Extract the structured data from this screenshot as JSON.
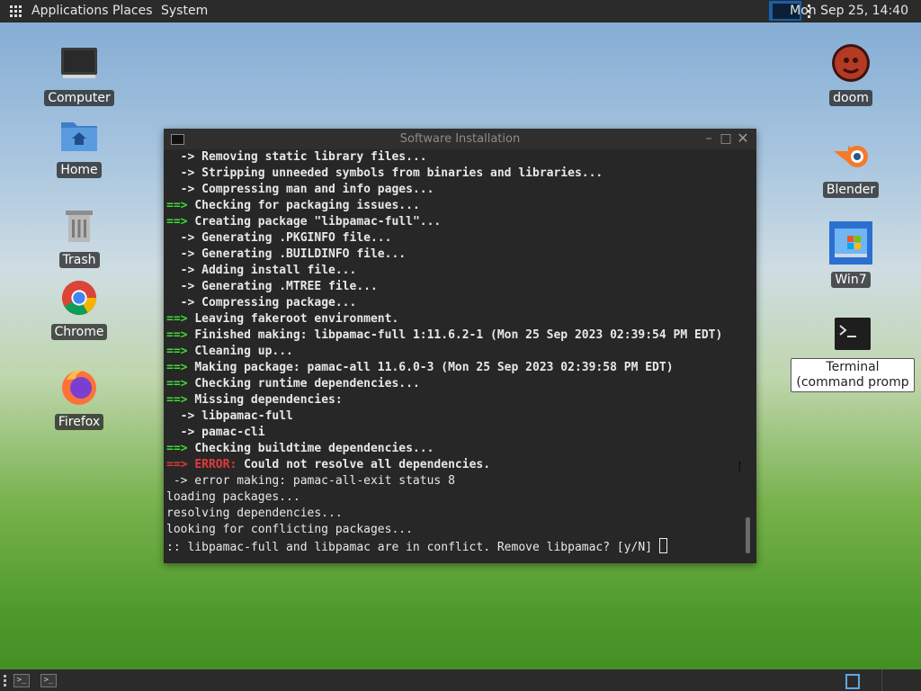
{
  "top_panel": {
    "applications": "Applications",
    "places": "Places",
    "system": "System",
    "clock": "Mon Sep 25, 14:40"
  },
  "desktop_left": [
    {
      "label": "Computer",
      "icon": "computer-icon"
    },
    {
      "label": "Home",
      "icon": "home-folder-icon"
    },
    {
      "label": "Trash",
      "icon": "trash-icon"
    },
    {
      "label": "Chrome",
      "icon": "chrome-icon"
    },
    {
      "label": "Firefox",
      "icon": "firefox-icon"
    }
  ],
  "desktop_right": [
    {
      "label": "doom",
      "icon": "doom-icon"
    },
    {
      "label": "Blender",
      "icon": "blender-icon"
    },
    {
      "label": "Win7",
      "icon": "win7-icon"
    },
    {
      "label": "Terminal (command promp",
      "icon": "terminal-icon"
    }
  ],
  "window": {
    "title": "Software Installation"
  },
  "terminal": {
    "lines": [
      [
        {
          "t": "  -> ",
          "c": "b"
        },
        {
          "t": "Removing static library files...",
          "c": "b"
        }
      ],
      [
        {
          "t": "  -> ",
          "c": "b"
        },
        {
          "t": "Stripping unneeded symbols from binaries and libraries...",
          "c": "b"
        }
      ],
      [
        {
          "t": "  -> ",
          "c": "b"
        },
        {
          "t": "Compressing man and info pages...",
          "c": "b"
        }
      ],
      [
        {
          "t": "==> ",
          "c": "green"
        },
        {
          "t": "Checking for packaging issues...",
          "c": "b"
        }
      ],
      [
        {
          "t": "==> ",
          "c": "green"
        },
        {
          "t": "Creating package \"libpamac-full\"...",
          "c": "b"
        }
      ],
      [
        {
          "t": "  -> ",
          "c": "b"
        },
        {
          "t": "Generating .PKGINFO file...",
          "c": "b"
        }
      ],
      [
        {
          "t": "  -> ",
          "c": "b"
        },
        {
          "t": "Generating .BUILDINFO file...",
          "c": "b"
        }
      ],
      [
        {
          "t": "  -> ",
          "c": "b"
        },
        {
          "t": "Adding install file...",
          "c": "b"
        }
      ],
      [
        {
          "t": "  -> ",
          "c": "b"
        },
        {
          "t": "Generating .MTREE file...",
          "c": "b"
        }
      ],
      [
        {
          "t": "  -> ",
          "c": "b"
        },
        {
          "t": "Compressing package...",
          "c": "b"
        }
      ],
      [
        {
          "t": "==> ",
          "c": "green"
        },
        {
          "t": "Leaving fakeroot environment.",
          "c": "b"
        }
      ],
      [
        {
          "t": "==> ",
          "c": "green"
        },
        {
          "t": "Finished making: libpamac-full 1:11.6.2-1 (Mon 25 Sep 2023 02:39:54 PM EDT)",
          "c": "b"
        }
      ],
      [
        {
          "t": "==> ",
          "c": "green"
        },
        {
          "t": "Cleaning up...",
          "c": "b"
        }
      ],
      [
        {
          "t": "==> ",
          "c": "green"
        },
        {
          "t": "Making package: pamac-all 11.6.0-3 (Mon 25 Sep 2023 02:39:58 PM EDT)",
          "c": "b"
        }
      ],
      [
        {
          "t": "==> ",
          "c": "green"
        },
        {
          "t": "Checking runtime dependencies...",
          "c": "b"
        }
      ],
      [
        {
          "t": "==> ",
          "c": "green"
        },
        {
          "t": "Missing dependencies:",
          "c": "b"
        }
      ],
      [
        {
          "t": "  -> ",
          "c": "b"
        },
        {
          "t": "libpamac-full",
          "c": "b"
        }
      ],
      [
        {
          "t": "  -> ",
          "c": "b"
        },
        {
          "t": "pamac-cli",
          "c": "b"
        }
      ],
      [
        {
          "t": "==> ",
          "c": "green"
        },
        {
          "t": "Checking buildtime dependencies...",
          "c": "b"
        }
      ],
      [
        {
          "t": "==> ",
          "c": "red"
        },
        {
          "t": "ERROR: ",
          "c": "red"
        },
        {
          "t": "Could not resolve all dependencies.",
          "c": "b"
        }
      ],
      [
        {
          "t": " -> error making: pamac-all-exit status 8",
          "c": ""
        }
      ],
      [
        {
          "t": "loading packages...",
          "c": ""
        }
      ],
      [
        {
          "t": "resolving dependencies...",
          "c": ""
        }
      ],
      [
        {
          "t": "looking for conflicting packages...",
          "c": ""
        }
      ],
      [
        {
          "t": ":: libpamac-full and libpamac are in conflict. Remove libpamac? [y/N] ",
          "c": ""
        }
      ]
    ]
  },
  "colors": {
    "panel": "#2b2b2b",
    "terminal_bg": "#272727",
    "prompt_green": "#3ddc35",
    "error_red": "#e23a3a"
  }
}
